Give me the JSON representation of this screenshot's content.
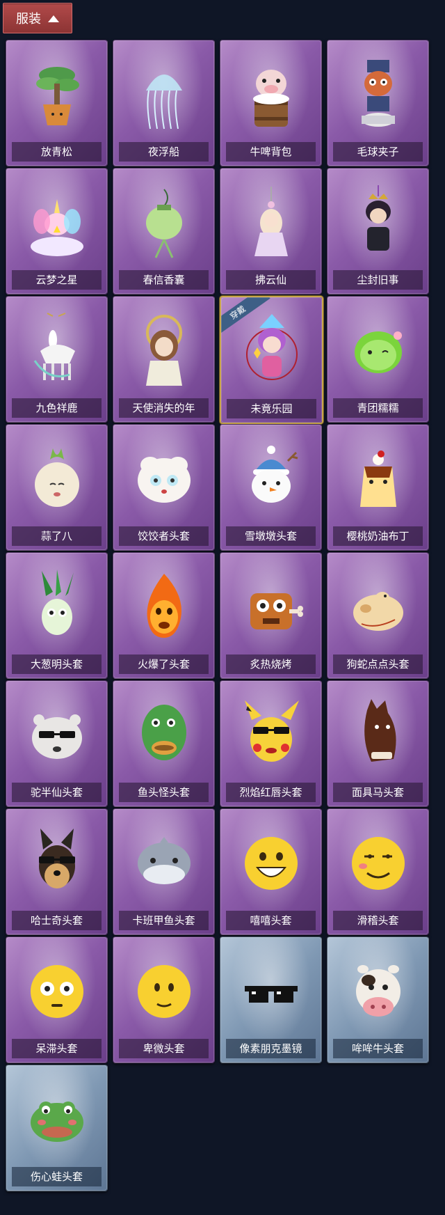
{
  "header": {
    "label": "服装"
  },
  "worn_badge": "穿戴",
  "items": [
    {
      "label": "放青松",
      "theme": "purple",
      "icon": "bonsai-tree-icon"
    },
    {
      "label": "夜浮船",
      "theme": "purple",
      "icon": "jellyfish-icon"
    },
    {
      "label": "牛啤背包",
      "theme": "purple",
      "icon": "cow-barrel-icon"
    },
    {
      "label": "毛球夹子",
      "theme": "purple",
      "icon": "raccoon-drummer-icon"
    },
    {
      "label": "云梦之星",
      "theme": "purple",
      "icon": "unicorn-cloud-icon"
    },
    {
      "label": "春信香囊",
      "theme": "purple",
      "icon": "sachet-icon"
    },
    {
      "label": "拂云仙",
      "theme": "purple",
      "icon": "fairy-charm-icon"
    },
    {
      "label": "尘封旧事",
      "theme": "purple",
      "icon": "prince-doll-icon"
    },
    {
      "label": "九色祥鹿",
      "theme": "purple",
      "icon": "deer-charm-icon"
    },
    {
      "label": "天使消失的年",
      "theme": "purple",
      "icon": "angel-girl-icon"
    },
    {
      "label": "未竟乐园",
      "theme": "purple",
      "icon": "clown-girl-icon",
      "worn": true
    },
    {
      "label": "青团糯糯",
      "theme": "purple",
      "icon": "green-dumpling-icon"
    },
    {
      "label": "蒜了八",
      "theme": "purple",
      "icon": "garlic-icon"
    },
    {
      "label": "饺饺者头套",
      "theme": "purple",
      "icon": "dumpling-head-icon"
    },
    {
      "label": "雪墩墩头套",
      "theme": "purple",
      "icon": "snowman-head-icon"
    },
    {
      "label": "樱桃奶油布丁",
      "theme": "purple",
      "icon": "pudding-icon"
    },
    {
      "label": "大葱明头套",
      "theme": "purple",
      "icon": "scallion-head-icon"
    },
    {
      "label": "火爆了头套",
      "theme": "purple",
      "icon": "fire-head-icon"
    },
    {
      "label": "炙热烧烤",
      "theme": "purple",
      "icon": "bbq-head-icon"
    },
    {
      "label": "狗蛇点点头套",
      "theme": "purple",
      "icon": "dog-snake-head-icon"
    },
    {
      "label": "驼半仙头套",
      "theme": "purple",
      "icon": "alpaca-head-icon"
    },
    {
      "label": "鱼头怪头套",
      "theme": "purple",
      "icon": "fish-head-icon"
    },
    {
      "label": "烈焰红唇头套",
      "theme": "purple",
      "icon": "yellow-mouse-head-icon"
    },
    {
      "label": "面具马头套",
      "theme": "purple",
      "icon": "horse-head-icon"
    },
    {
      "label": "哈士奇头套",
      "theme": "purple",
      "icon": "husky-head-icon"
    },
    {
      "label": "卡班甲鱼头套",
      "theme": "purple",
      "icon": "whale-head-icon"
    },
    {
      "label": "嘻嘻头套",
      "theme": "purple",
      "icon": "grin-emoji-head-icon"
    },
    {
      "label": "滑稽头套",
      "theme": "purple",
      "icon": "smirk-emoji-head-icon"
    },
    {
      "label": "呆滞头套",
      "theme": "purple",
      "icon": "stunned-emoji-head-icon"
    },
    {
      "label": "卑微头套",
      "theme": "purple",
      "icon": "humble-emoji-head-icon"
    },
    {
      "label": "像素朋克墨镜",
      "theme": "blue",
      "icon": "pixel-sunglasses-icon"
    },
    {
      "label": "哞哞牛头套",
      "theme": "blue",
      "icon": "cow-head-icon"
    },
    {
      "label": "伤心蛙头套",
      "theme": "blue",
      "icon": "sad-frog-head-icon"
    }
  ]
}
